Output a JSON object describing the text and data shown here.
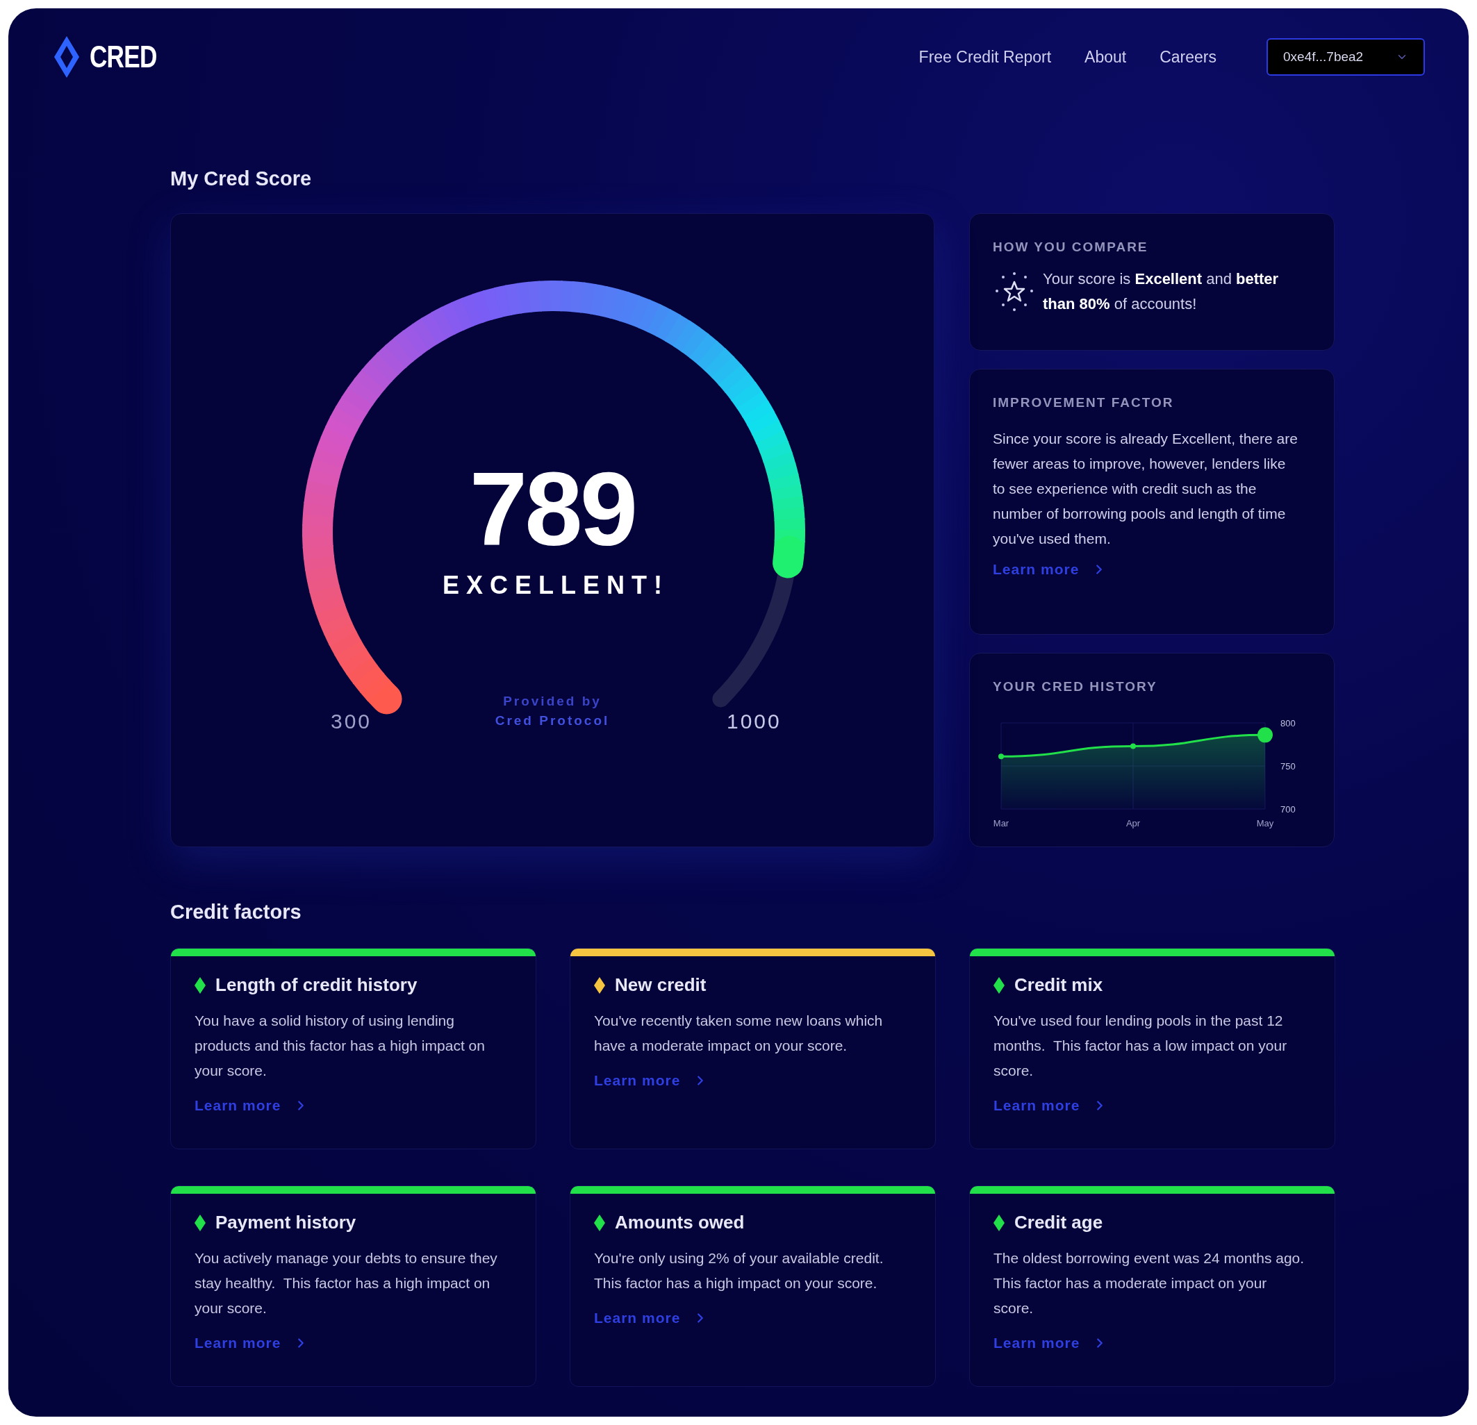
{
  "header": {
    "logo": "CRED",
    "nav": [
      "Free Credit Report",
      "About",
      "Careers"
    ],
    "wallet": "0xe4f...7bea2"
  },
  "score_section": {
    "title": "My Cred Score",
    "gauge": {
      "score": "789",
      "rating": "EXCELLENT!",
      "min": "300",
      "max": "1000",
      "provided_by": "Provided by",
      "provider": "Cred Protocol"
    }
  },
  "compare": {
    "title": "HOW YOU COMPARE",
    "text": "Your score is **Excellent** and **better than 80%** of accounts!"
  },
  "improvement": {
    "title": "IMPROVEMENT FACTOR",
    "text": "Since your score is already Excellent, there are fewer areas to improve, however, lenders like to see experience with credit such as the number of borrowing pools and length of time you've used them.",
    "link": "Learn more"
  },
  "history": {
    "title": "YOUR CRED HISTORY",
    "chart_data": {
      "type": "area",
      "categories": [
        "Mar",
        "Apr",
        "May"
      ],
      "series": [
        {
          "color": "#22e04a",
          "values": [
            761,
            773,
            786
          ]
        }
      ],
      "ylim": [
        700,
        800
      ],
      "yticks": [
        700,
        750,
        800
      ]
    }
  },
  "factors": {
    "title": "Credit factors",
    "items": [
      {
        "title": "Length of credit history",
        "text": "You have a solid history of using lending products and this factor has a high impact on your score.",
        "link": "Learn more",
        "color": "#22e04a"
      },
      {
        "title": "New credit",
        "text": "You've recently taken some new loans which have a moderate impact on your score.",
        "link": "Learn more",
        "color": "#f5c542"
      },
      {
        "title": "Credit mix",
        "text": "You've used four lending pools in the past 12 months.  This factor has a low impact on your score.",
        "link": "Learn more",
        "color": "#22e04a"
      },
      {
        "title": "Payment history",
        "text": "You actively manage your debts to ensure they stay healthy.  This factor has a high impact on your score.",
        "link": "Learn more",
        "color": "#22e04a"
      },
      {
        "title": "Amounts owed",
        "text": "You're only using 2% of your available credit.  This factor has a high impact on your score.",
        "link": "Learn more",
        "color": "#22e04a"
      },
      {
        "title": "Credit age",
        "text": "The oldest borrowing event was 24 months ago.  This factor has a moderate impact on your score.",
        "link": "Learn more",
        "color": "#22e04a"
      }
    ]
  }
}
